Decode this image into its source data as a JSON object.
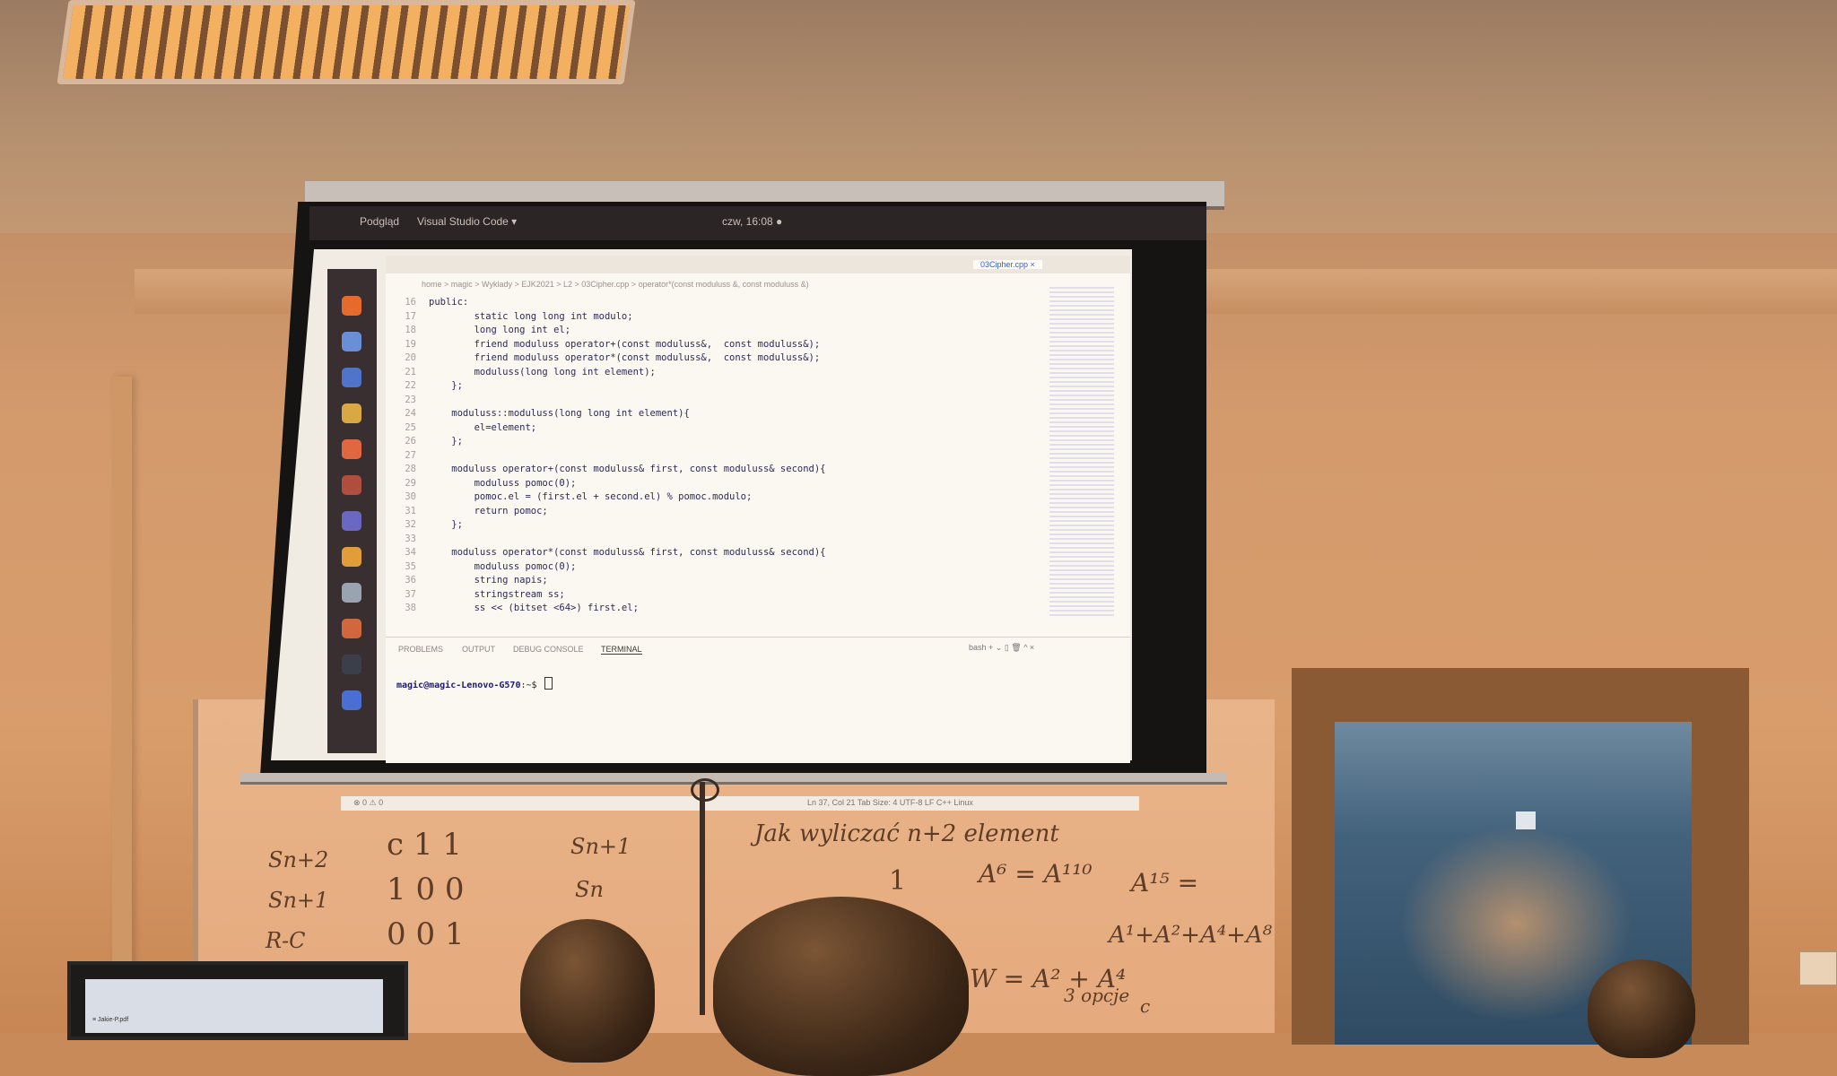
{
  "topbar": {
    "activities": "Podgląd",
    "app_menu": "Visual Studio Code ▾",
    "clock": "czw, 16:08 ●"
  },
  "editor": {
    "active_tab": "03Cipher.cpp ×",
    "breadcrumb": "home > magic > Wyklady > EJK2021 > L2 > 03Cipher.cpp > operator*(const moduluss &, const moduluss &)",
    "lines": [
      {
        "n": "16",
        "text": "public:"
      },
      {
        "n": "17",
        "text": "        static long long int modulo;"
      },
      {
        "n": "18",
        "text": "        long long int el;"
      },
      {
        "n": "19",
        "text": "        friend moduluss operator+(const moduluss&,  const moduluss&);"
      },
      {
        "n": "20",
        "text": "        friend moduluss operator*(const moduluss&,  const moduluss&);"
      },
      {
        "n": "21",
        "text": "        moduluss(long long int element);"
      },
      {
        "n": "22",
        "text": "    };"
      },
      {
        "n": "23",
        "text": ""
      },
      {
        "n": "24",
        "text": "    moduluss::moduluss(long long int element){"
      },
      {
        "n": "25",
        "text": "        el=element;"
      },
      {
        "n": "26",
        "text": "    };"
      },
      {
        "n": "27",
        "text": ""
      },
      {
        "n": "28",
        "text": "    moduluss operator+(const moduluss& first, const moduluss& second){"
      },
      {
        "n": "29",
        "text": "        moduluss pomoc(0);"
      },
      {
        "n": "30",
        "text": "        pomoc.el = (first.el + second.el) % pomoc.modulo;"
      },
      {
        "n": "31",
        "text": "        return pomoc;"
      },
      {
        "n": "32",
        "text": "    };"
      },
      {
        "n": "33",
        "text": ""
      },
      {
        "n": "34",
        "text": "    moduluss operator*(const moduluss& first, const moduluss& second){"
      },
      {
        "n": "35",
        "text": "        moduluss pomoc(0);"
      },
      {
        "n": "36",
        "text": "        string napis;"
      },
      {
        "n": "37",
        "text": "        stringstream ss;"
      },
      {
        "n": "38",
        "text": "        ss << (bitset <64>) first.el;"
      }
    ]
  },
  "panel": {
    "tabs": [
      "PROBLEMS",
      "OUTPUT",
      "DEBUG CONSOLE",
      "TERMINAL"
    ],
    "shell": "bash  +  ⌄  ▯  🗑  ^  ×",
    "prompt_user": "magic@magic-Lenovo-G570",
    "prompt_tail": ":~$ "
  },
  "statusbar": {
    "left": "⊗ 0 ⚠ 0",
    "right": "Ln 37, Col 21   Tab Size: 4   UTF-8   LF   C++   Linux"
  },
  "whiteboard": {
    "title": "Jak wyliczać n+2 element",
    "s_n2": "Sn+2",
    "s_n1": "Sn+1",
    "rc": "R-C",
    "matrix_row1": "c  1  1",
    "matrix_row2": "1  0  0",
    "matrix_row3": "0  0  1",
    "s_n1b": "Sn+1",
    "s_n": "Sn",
    "one": "1",
    "eq_a6": "A⁶ = A¹¹⁰",
    "eq_a15": "A¹⁵ =",
    "eq_sum": "A¹+A²+A⁴+A⁸",
    "eq_w": "W = A² + A⁴",
    "note": "3 opcje",
    "lower": "c"
  },
  "monitor": {
    "tab": "≡ Jakie-P.pdf"
  }
}
